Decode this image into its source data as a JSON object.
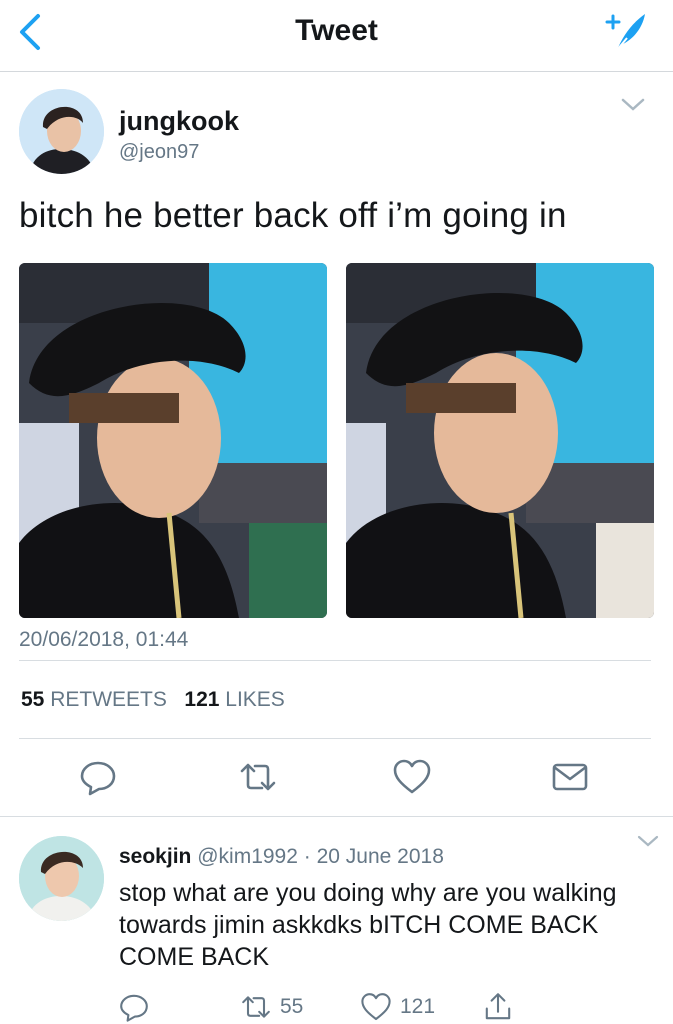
{
  "header": {
    "title": "Tweet",
    "back_icon": "chevron-left-icon",
    "compose_icon": "compose-feather-icon",
    "accent": "#1da1f2"
  },
  "tweet": {
    "author_name": "jungkook",
    "author_handle": "@jeon97",
    "text": "bitch he better back off i’m going in",
    "timestamp": "20/06/2018, 01:44",
    "retweet_count": "55",
    "retweet_label": "RETWEETS",
    "like_count": "121",
    "like_label": "LIKES",
    "photos": [
      "photo-1",
      "photo-2"
    ]
  },
  "actions": [
    "reply-icon",
    "retweet-icon",
    "like-icon",
    "share-mail-icon"
  ],
  "reply": {
    "author_name": "seokjin",
    "author_handle": "@kim1992",
    "separator": "·",
    "date": "20 June 2018",
    "text": "stop what are you doing why are you walking towards jimin askkdks bITCH COME BACK COME BACK",
    "retweet_count": "55",
    "like_count": "121"
  }
}
